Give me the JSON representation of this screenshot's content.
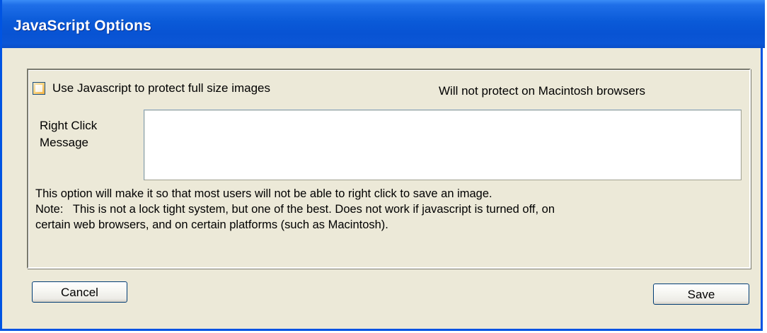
{
  "window": {
    "title": "JavaScript Options"
  },
  "protect_checkbox": {
    "label": "Use Javascript to protect full size images",
    "checked": false
  },
  "mac_note": "Will not protect on Macintosh browsers",
  "right_click": {
    "label": "Right Click Message",
    "value": ""
  },
  "description": {
    "line1": "This option will make it so that most users will not be able to right click to save an image.",
    "line2": "Note:   This is not a lock tight system, but one of the best. Does not work if javascript is turned off, on",
    "line3": "certain web browsers, and on certain platforms (such as Macintosh)."
  },
  "buttons": {
    "cancel": "Cancel",
    "save": "Save"
  },
  "colors": {
    "titlebar": "#0a5ad8",
    "dialog_bg": "#ece9d8",
    "checkbox_accent": "#f5b142"
  }
}
